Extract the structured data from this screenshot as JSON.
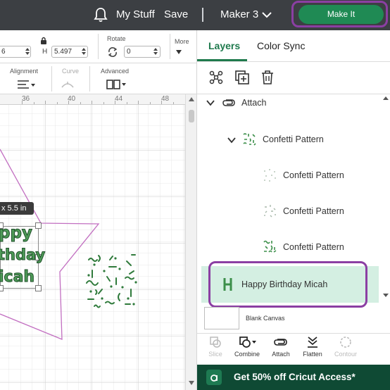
{
  "topbar": {
    "my_stuff": "My Stuff",
    "save": "Save",
    "machine": "Maker 3",
    "make_it": "Make It",
    "bar_color": "#3c3f43",
    "accent": "#1f8a54",
    "highlight": "#8b3fa3"
  },
  "toolbar": {
    "width_value": "6",
    "height_label": "H",
    "height_value": "5.497",
    "rotate_label": "Rotate",
    "rotate_value": "0",
    "more_label": "More",
    "alignment_label": "Alignment",
    "curve_label": "Curve",
    "advanced_label": "Advanced"
  },
  "ruler": [
    "36",
    "40",
    "44",
    "48"
  ],
  "canvas": {
    "size_tooltip": "x 5.5  in",
    "card_lines": [
      "ppy",
      "thday",
      "icah"
    ],
    "star_color": "#c26fc1"
  },
  "panel": {
    "tabs": [
      "Layers",
      "Color Sync"
    ],
    "active_tab": "Layers",
    "layers": [
      {
        "name": "Attach",
        "level": 0,
        "icon": "attach-icon",
        "expanded": true
      },
      {
        "name": "Confetti Pattern",
        "level": 1,
        "icon": "confetti-thumbnail",
        "expanded": true
      },
      {
        "name": "Confetti Pattern",
        "level": 2,
        "icon": "confetti-thumbnail"
      },
      {
        "name": "Confetti Pattern",
        "level": 2,
        "icon": "confetti-thumbnail"
      },
      {
        "name": "Confetti Pattern",
        "level": 2,
        "icon": "confetti-thumbnail"
      },
      {
        "name": "Happy Birthday Micah",
        "level": 1,
        "icon": "text-thumbnail",
        "selected": true
      }
    ],
    "blank_canvas": "Blank Canvas",
    "actions": [
      {
        "label": "Slice",
        "enabled": false
      },
      {
        "label": "Combine",
        "enabled": true
      },
      {
        "label": "Attach",
        "enabled": true
      },
      {
        "label": "Flatten",
        "enabled": true
      },
      {
        "label": "Contour",
        "enabled": false
      }
    ],
    "promo": "Get 50% off Cricut Access*"
  }
}
